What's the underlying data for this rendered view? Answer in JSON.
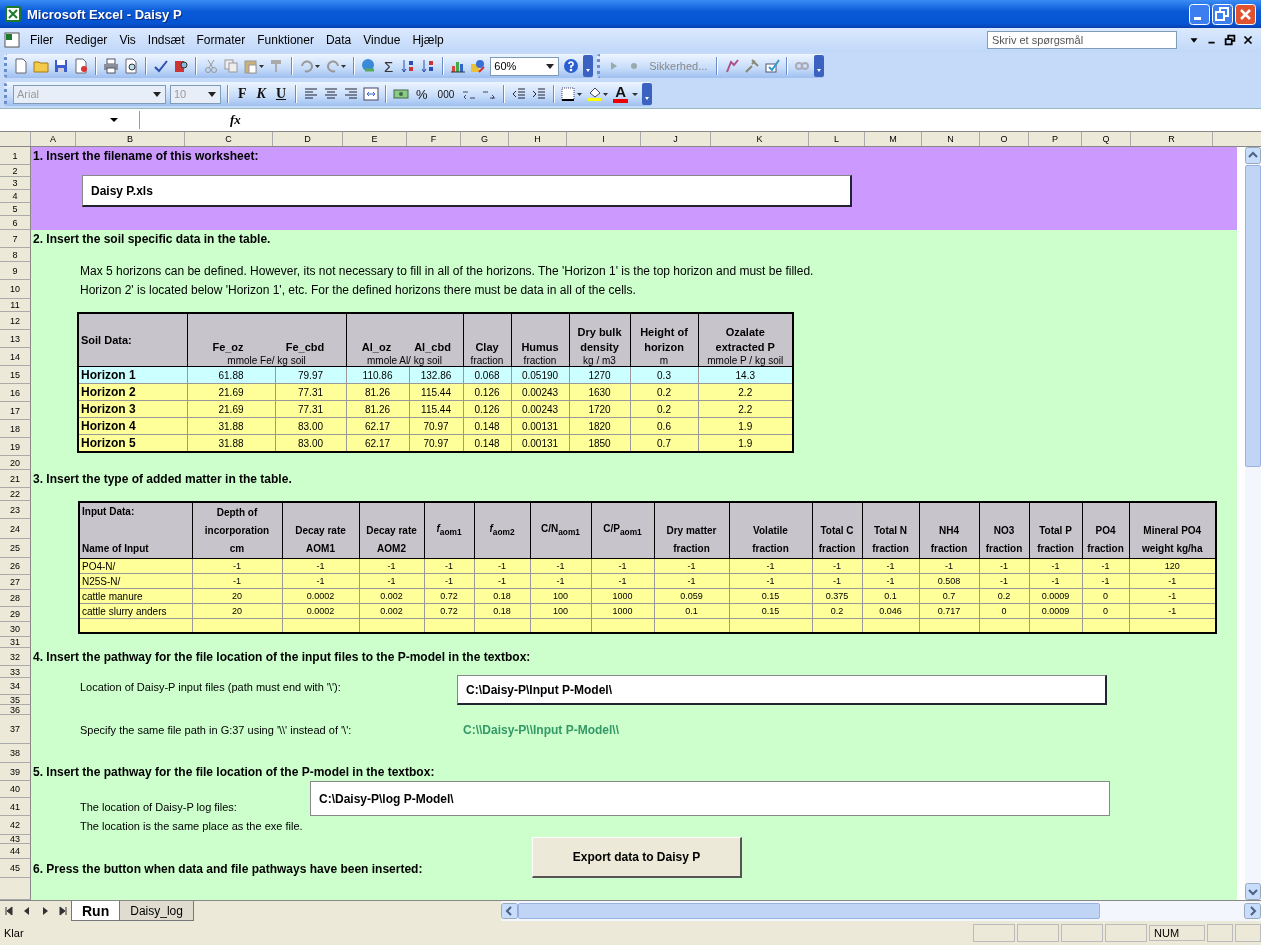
{
  "window": {
    "title": "Microsoft Excel - Daisy P"
  },
  "menu": [
    "Filer",
    "Rediger",
    "Vis",
    "Indsæt",
    "Formater",
    "Funktioner",
    "Data",
    "Vindue",
    "Hjælp"
  ],
  "help_box": {
    "placeholder": "Skriv et spørgsmål"
  },
  "standard_toolbar": {
    "autosum": "Σ",
    "zoom": "60%",
    "security": "Sikkerhed..."
  },
  "formatting_toolbar": {
    "font": "Arial",
    "size": "10",
    "bold": "F",
    "italic": "K",
    "underline": "U",
    "percent": "%",
    "thousands": "000",
    "font_color": "A"
  },
  "formula_bar": {
    "function_label": "fx"
  },
  "columns": [
    "A",
    "B",
    "C",
    "D",
    "E",
    "F",
    "G",
    "H",
    "I",
    "J",
    "K",
    "L",
    "M",
    "N",
    "O",
    "P",
    "Q",
    "R"
  ],
  "rows": [
    "1",
    "2",
    "3",
    "4",
    "5",
    "6",
    "7",
    "8",
    "9",
    "10",
    "11",
    "12",
    "13",
    "14",
    "15",
    "16",
    "17",
    "18",
    "19",
    "20",
    "21",
    "22",
    "23",
    "24",
    "25",
    "26",
    "27",
    "28",
    "29",
    "30",
    "31",
    "32",
    "33",
    "34",
    "35",
    "36",
    "37",
    "38",
    "39",
    "40",
    "41",
    "42",
    "43",
    "44",
    "45"
  ],
  "sheet": {
    "step_1": {
      "heading": "1. Insert the filename of this worksheet:",
      "filename": "Daisy P.xls"
    },
    "step_2": {
      "heading": "2. Insert the soil specific data in the table.",
      "notes": [
        "Max 5 horizons can be defined. However, its not necessary to fill in all of the horizons. The 'Horizon 1' is the top horizon and must be filled.",
        "Horizon 2' is located below 'Horizon 1', etc. For the defined horizons there must be data in all of the cells."
      ],
      "soil_table": {
        "columns": [
          {
            "labels": [
              {
                "lines": [
                  "Soil Data:"
                ]
              }
            ]
          },
          {
            "labels": [
              {
                "lines": [
                  "Fe_oz"
                ]
              },
              {
                "lines": [
                  "Fe_cbd"
                ]
              }
            ],
            "unit": "mmole Fe/ kg soil"
          },
          {
            "labels": [
              {
                "lines": [
                  "Al_oz"
                ]
              },
              {
                "lines": [
                  "Al_cbd"
                ]
              }
            ],
            "unit": "mmole Al/ kg soil"
          },
          {
            "labels": [
              {
                "lines": [
                  "Clay"
                ]
              }
            ],
            "unit": "fraction"
          },
          {
            "labels": [
              {
                "lines": [
                  "Humus"
                ]
              }
            ],
            "unit": "fraction"
          },
          {
            "labels": [
              {
                "lines": [
                  "Dry bulk",
                  "density"
                ]
              }
            ],
            "unit": "kg / m3"
          },
          {
            "labels": [
              {
                "lines": [
                  "Height of",
                  "horizon"
                ]
              }
            ],
            "unit": "m"
          },
          {
            "labels": [
              {
                "lines": [
                  "Ozalate",
                  "extracted P"
                ]
              }
            ],
            "unit": "mmole P / kg soil"
          }
        ],
        "rows": [
          {
            "name": "Horizon 1",
            "highlighted": true,
            "values": [
              "61.88",
              "79.97",
              "110.86",
              "132.86",
              "0.068",
              "0.05190",
              "1270",
              "0.3",
              "14.3"
            ]
          },
          {
            "name": "Horizon 2",
            "highlighted": false,
            "values": [
              "21.69",
              "77.31",
              "81.26",
              "115.44",
              "0.126",
              "0.00243",
              "1630",
              "0.2",
              "2.2"
            ]
          },
          {
            "name": "Horizon 3",
            "highlighted": false,
            "values": [
              "21.69",
              "77.31",
              "81.26",
              "115.44",
              "0.126",
              "0.00243",
              "1720",
              "0.2",
              "2.2"
            ]
          },
          {
            "name": "Horizon 4",
            "highlighted": false,
            "values": [
              "31.88",
              "83.00",
              "62.17",
              "70.97",
              "0.148",
              "0.00131",
              "1820",
              "0.6",
              "1.9"
            ]
          },
          {
            "name": "Horizon 5",
            "highlighted": false,
            "values": [
              "31.88",
              "83.00",
              "62.17",
              "70.97",
              "0.148",
              "0.00131",
              "1850",
              "0.7",
              "1.9"
            ]
          }
        ]
      }
    },
    "step_3": {
      "heading": "3. Insert the type of added matter in the table.",
      "input_table": {
        "columns": [
          {
            "lines": [
              "Input Data:",
              "Name of Input"
            ]
          },
          {
            "lines": [
              "Depth of",
              "incorporation",
              "cm"
            ]
          },
          {
            "lines": [
              "Decay rate",
              "AOM1"
            ]
          },
          {
            "lines": [
              "Decay rate",
              "AOM2"
            ]
          },
          {
            "lines": [
              "*f*$_{aom1}$"
            ]
          },
          {
            "lines": [
              "*f*$_{aom2}$"
            ]
          },
          {
            "lines": [
              "C/N$_{aom1}$"
            ]
          },
          {
            "lines": [
              "C/P$_{aom1}$"
            ]
          },
          {
            "lines": [
              "Dry matter",
              "fraction"
            ]
          },
          {
            "lines": [
              "Volatile",
              "fraction"
            ]
          },
          {
            "lines": [
              "Total C",
              "fraction"
            ]
          },
          {
            "lines": [
              "Total N",
              "fraction"
            ]
          },
          {
            "lines": [
              "NH4",
              "fraction"
            ]
          },
          {
            "lines": [
              "NO3",
              "fraction"
            ]
          },
          {
            "lines": [
              "Total P",
              "fraction"
            ]
          },
          {
            "lines": [
              "PO4",
              "fraction"
            ]
          },
          {
            "lines": [
              "Mineral PO4",
              "weight kg/ha"
            ]
          }
        ],
        "rows": [
          {
            "name": "PO4-N/",
            "values": [
              "-1",
              "-1",
              "-1",
              "-1",
              "-1",
              "-1",
              "-1",
              "-1",
              "-1",
              "-1",
              "-1",
              "-1",
              "-1",
              "-1",
              "-1",
              "120"
            ]
          },
          {
            "name": "N25S-N/",
            "values": [
              "-1",
              "-1",
              "-1",
              "-1",
              "-1",
              "-1",
              "-1",
              "-1",
              "-1",
              "-1",
              "-1",
              "0.508",
              "-1",
              "-1",
              "-1",
              "-1"
            ]
          },
          {
            "name": "cattle manure",
            "values": [
              "20",
              "0.0002",
              "0.002",
              "0.72",
              "0.18",
              "100",
              "1000",
              "0.059",
              "0.15",
              "0.375",
              "0.1",
              "0.7",
              "0.2",
              "0.0009",
              "0",
              "-1"
            ]
          },
          {
            "name": "cattle slurry anders",
            "values": [
              "20",
              "0.0002",
              "0.002",
              "0.72",
              "0.18",
              "100",
              "1000",
              "0.1",
              "0.15",
              "0.2",
              "0.046",
              "0.717",
              "0",
              "0.0009",
              "0",
              "-1"
            ]
          }
        ]
      }
    },
    "step_4": {
      "heading": "4. Insert the pathway for the file location of the input files to the P-model in the textbox:",
      "path_label": "Location of Daisy-P input files (path must end with '\\'):",
      "path": "C:\\Daisy-P\\Input P-Model\\",
      "escaped_label": "Specify the same file path in G:37 using '\\\\' instead of '\\':",
      "escaped_path": "C:\\\\Daisy-P\\\\Input P-Model\\\\"
    },
    "step_5": {
      "heading": "5. Insert the pathway for the file location of the P-model in the textbox:",
      "log_label": "The location of Daisy-P log files:",
      "log_path": "C:\\Daisy-P\\log P-Model\\",
      "note": "The location is the same place as the exe file."
    },
    "step_6": {
      "heading": "6. Press the button when data and file pathways have been inserted:",
      "button": "Export data to Daisy P"
    }
  },
  "sheet_tabs": [
    {
      "label": "Run",
      "selected": true
    },
    {
      "label": "Daisy_log",
      "selected": false
    }
  ],
  "status_bar": {
    "status": "Klar",
    "indicator": "NUM"
  }
}
